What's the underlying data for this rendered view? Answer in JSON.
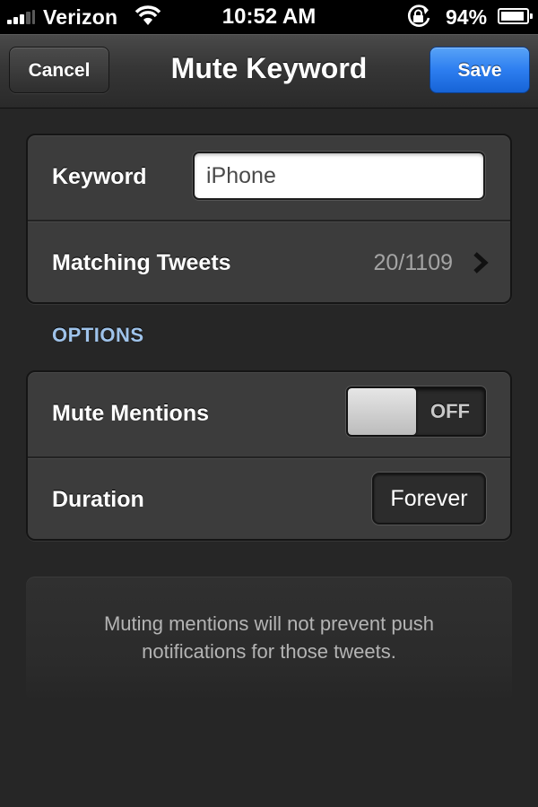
{
  "status_bar": {
    "carrier": "Verizon",
    "time": "10:52 AM",
    "battery_percent": "94%",
    "battery_level": 0.94,
    "icons": [
      "signal-bars-icon",
      "wifi-icon",
      "rotation-lock-icon",
      "battery-icon"
    ]
  },
  "nav": {
    "title": "Mute Keyword",
    "cancel_label": "Cancel",
    "save_label": "Save"
  },
  "keyword_group": {
    "keyword_label": "Keyword",
    "keyword_value": "iPhone",
    "matching_label": "Matching Tweets",
    "matching_value": "20/1109"
  },
  "options": {
    "header": "OPTIONS",
    "mute_mentions_label": "Mute Mentions",
    "mute_mentions_state": "OFF",
    "duration_label": "Duration",
    "duration_value": "Forever"
  },
  "footer_note": {
    "line1": "Muting mentions will not prevent push",
    "line2": "notifications for those tweets."
  },
  "colors": {
    "background": "#262626",
    "accent_blue": "#2d7ef0",
    "section_header": "#9fc3ea"
  }
}
